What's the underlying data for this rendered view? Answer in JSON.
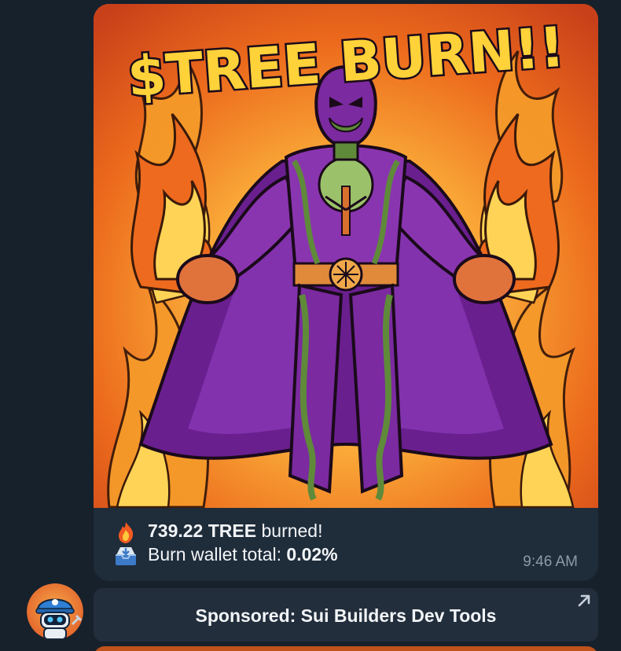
{
  "message": {
    "image": {
      "headline": "$TREE BURN!!",
      "alt": "Comic hero in purple suit with tree emblem standing in flames"
    },
    "caption": {
      "line1": {
        "icon": "fire-icon",
        "amount": "739.22 TREE",
        "suffix": "burned!"
      },
      "line2": {
        "icon": "inbox-tray-icon",
        "label": "Burn wallet total:",
        "value": "0.02%"
      }
    },
    "time": "9:46 AM"
  },
  "sponsored": {
    "label": "Sponsored: Sui Builders Dev Tools",
    "open_icon": "arrow-up-right-icon",
    "avatar_icon": "robot-avatar-icon"
  },
  "colors": {
    "background": "#17212b",
    "bubble": "#1f2c3a",
    "sponsored_bg": "#232e3c",
    "text": "#f2f5f8",
    "muted": "#8d9aa8",
    "flame_orange": "#e8731c",
    "hero_purple": "#7b2aa0",
    "leaf_green": "#5f8a3a"
  }
}
